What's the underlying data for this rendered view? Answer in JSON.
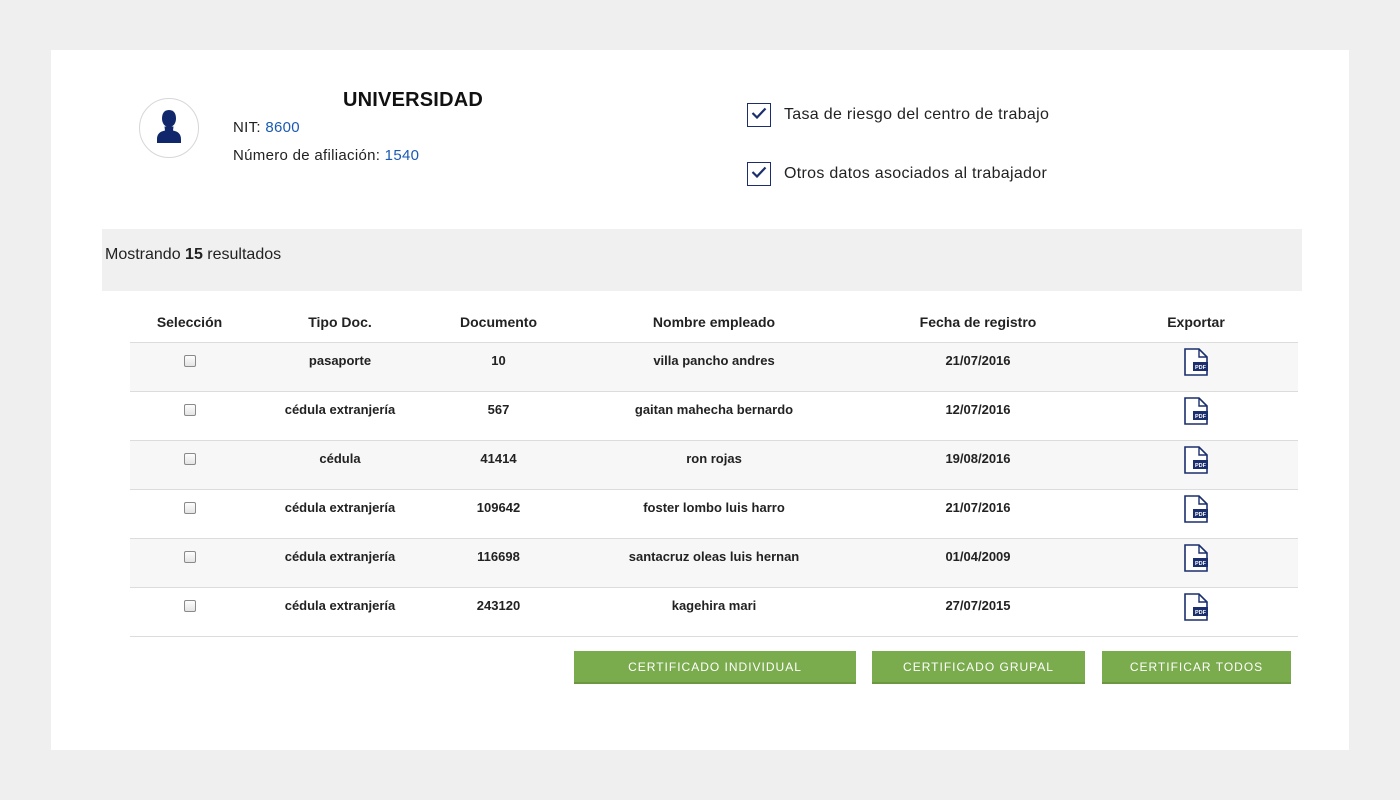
{
  "company": {
    "name": "UNIVERSIDAD",
    "nit_label": "NIT:",
    "nit_value": "8600",
    "afiliacion_label": "Número de afiliación:",
    "afiliacion_value": "1540"
  },
  "options": [
    {
      "label": "Tasa de riesgo del centro de trabajo",
      "checked": true
    },
    {
      "label": "Otros datos asociados al trabajador",
      "checked": true
    }
  ],
  "results": {
    "prefix": "Mostrando",
    "count": "15",
    "suffix": "resultados"
  },
  "table": {
    "headers": [
      "Selección",
      "Tipo Doc.",
      "Documento",
      "Nombre empleado",
      "Fecha de registro",
      "Exportar"
    ],
    "rows": [
      {
        "tipo": "pasaporte",
        "documento": "10",
        "nombre": "villa pancho andres",
        "fecha": "21/07/2016",
        "export_icon": "pdf-icon"
      },
      {
        "tipo": "cédula extranjería",
        "documento": "567",
        "nombre": "gaitan mahecha bernardo",
        "fecha": "12/07/2016",
        "export_icon": "pdf-icon"
      },
      {
        "tipo": "cédula",
        "documento": "41414",
        "nombre": "ron rojas",
        "fecha": "19/08/2016",
        "export_icon": "pdf-icon"
      },
      {
        "tipo": "cédula extranjería",
        "documento": "109642",
        "nombre": "foster lombo luis harro",
        "fecha": "21/07/2016",
        "export_icon": "pdf-icon"
      },
      {
        "tipo": "cédula extranjería",
        "documento": "116698",
        "nombre": "santacruz oleas luis hernan",
        "fecha": "01/04/2009",
        "export_icon": "pdf-icon"
      },
      {
        "tipo": "cédula extranjería",
        "documento": "243120",
        "nombre": "kagehira mari",
        "fecha": "27/07/2015",
        "export_icon": "pdf-icon"
      }
    ]
  },
  "buttons": {
    "individual": "CERTIFICADO INDIVIDUAL",
    "grupal": "CERTIFICADO GRUPAL",
    "todos": "CERTIFICAR TODOS"
  },
  "icons": {
    "pdf_badge": "PDF",
    "avatar": "user-silhouette-icon",
    "checkmark": "checkmark-icon"
  },
  "colors": {
    "accent_link": "#1a5ab5",
    "button_green": "#7aab4d",
    "icon_navy": "#1b2f6e"
  }
}
